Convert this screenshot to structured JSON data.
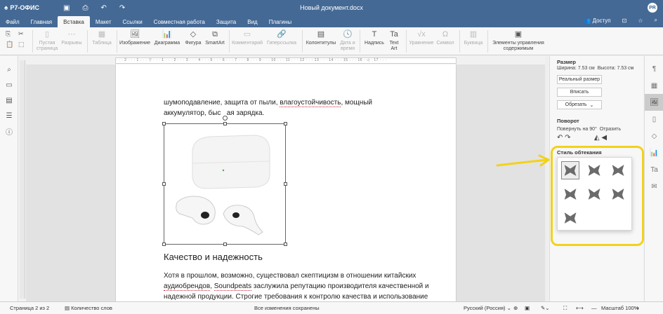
{
  "app": {
    "name": "Р7-ОФИС",
    "doc_title": "Новый документ.docx",
    "avatar": "PR"
  },
  "menu": {
    "tabs": [
      "Файл",
      "Главная",
      "Вставка",
      "Макет",
      "Ссылки",
      "Совместная работа",
      "Защита",
      "Вид",
      "Плагины"
    ],
    "active_tab": "Вставка",
    "share": "Доступ"
  },
  "ribbon": {
    "blank_page": "Пустая\nстраница",
    "breaks": "Разрывы",
    "table": "Таблица",
    "image": "Изображение",
    "chart": "Диаграмма",
    "shape": "Фигура",
    "smartart": "SmartArt",
    "comment": "Комментарий",
    "hyperlink": "Гиперссылка",
    "header_footer": "Колонтитулы",
    "date_time": "Дата и\nвремя",
    "text_box": "Надпись",
    "text_art": "Text\nArt",
    "equation": "Уравнение",
    "symbol": "Символ",
    "drop_cap": "Буквица",
    "content_controls": "Элементы управления\nсодержимым"
  },
  "ruler": "· · · 2 · · · 1 · · · ▽ · · · 1 · · · 2 · · · 3 · · · 4 · · · 5 · · · 6 · · · 7 · · · 8 · · · 9 · · · 10 · · · 11 · · · 12 · · · 13 · · · 14 · · · 15 · · · 16 · ◁ · 17 · · ·",
  "document": {
    "line1_a": "шумоподавление, защита от пыли, ",
    "line1_u": "влагоустойчивость",
    "line1_b": ", мощный",
    "line2": "аккумулятор, быс",
    "line2_b": "ая зарядка.",
    "heading": "Качество и надежность",
    "p1": "Хотя в прошлом, возможно, существовал скептицизм в отношении китайских",
    "p2_u1": "аудиобрендов",
    "p2_sep": ", ",
    "p2_u2": "Soundpeats",
    "p2_rest": " заслужила репутацию производителя качественной и",
    "p3": "надежной продукции. Строгие требования к контролю качества и использование"
  },
  "panel": {
    "size_title": "Размер",
    "width": "Ширина: 7.53 см",
    "height": "Высота: 7.53 см",
    "actual_size": "Реальный размер",
    "fit": "Вписать",
    "crop": "Обрезать",
    "rotation_title": "Поворот",
    "rotate_90": "Повернуть на 90°",
    "flip": "Отразить",
    "wrap_title": "Стиль обтекания"
  },
  "status": {
    "page": "Страница 2 из 2",
    "word_count": "Количество слов",
    "saved": "Все изменения сохранены",
    "language": "Русский (Россия)",
    "zoom": "Масштаб 100%"
  },
  "colors": {
    "header": "#446995",
    "highlight": "#f2d21b"
  }
}
